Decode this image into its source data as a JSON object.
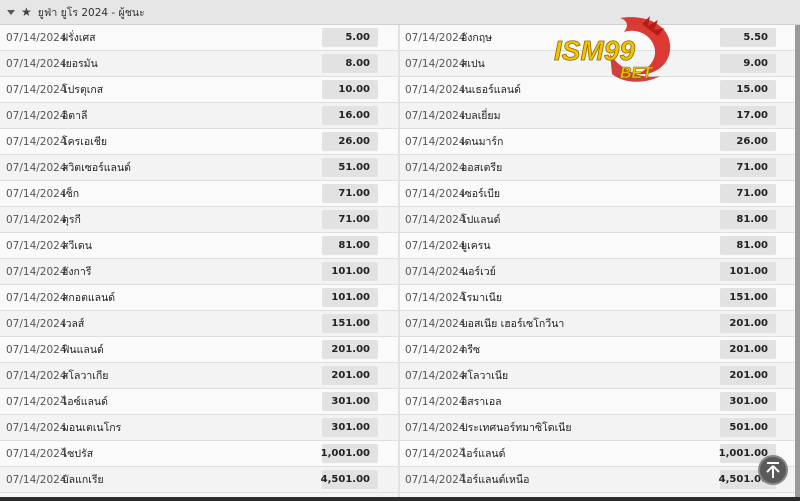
{
  "header": {
    "title": "ยูฟ่า ยูโร 2024 - ผู้ชนะ"
  },
  "logo": {
    "text_main": "ISM99",
    "text_sub": "BET"
  },
  "rows": [
    {
      "l_date": "07/14/2024",
      "l_team": "ฝรั่งเศส",
      "l_odds": "5.00",
      "r_date": "07/14/2024",
      "r_team": "อังกฤษ",
      "r_odds": "5.50"
    },
    {
      "l_date": "07/14/2024",
      "l_team": "เยอรมัน",
      "l_odds": "8.00",
      "r_date": "07/14/2024",
      "r_team": "สเปน",
      "r_odds": "9.00"
    },
    {
      "l_date": "07/14/2024",
      "l_team": "โปรตุเกส",
      "l_odds": "10.00",
      "r_date": "07/14/2024",
      "r_team": "เนเธอร์แลนด์",
      "r_odds": "15.00"
    },
    {
      "l_date": "07/14/2024",
      "l_team": "อิตาลี",
      "l_odds": "16.00",
      "r_date": "07/14/2024",
      "r_team": "เบลเยี่ยม",
      "r_odds": "17.00"
    },
    {
      "l_date": "07/14/2024",
      "l_team": "โครเอเชีย",
      "l_odds": "26.00",
      "r_date": "07/14/2024",
      "r_team": "เดนมาร์ก",
      "r_odds": "26.00"
    },
    {
      "l_date": "07/14/2024",
      "l_team": "สวิตเซอร์แลนด์",
      "l_odds": "51.00",
      "r_date": "07/14/2024",
      "r_team": "ออสเตรีย",
      "r_odds": "71.00"
    },
    {
      "l_date": "07/14/2024",
      "l_team": "เช็ก",
      "l_odds": "71.00",
      "r_date": "07/14/2024",
      "r_team": "เซอร์เบีย",
      "r_odds": "71.00"
    },
    {
      "l_date": "07/14/2024",
      "l_team": "ตุรกี",
      "l_odds": "71.00",
      "r_date": "07/14/2024",
      "r_team": "โปแลนด์",
      "r_odds": "81.00"
    },
    {
      "l_date": "07/14/2024",
      "l_team": "สวีเดน",
      "l_odds": "81.00",
      "r_date": "07/14/2024",
      "r_team": "ยูเครน",
      "r_odds": "81.00"
    },
    {
      "l_date": "07/14/2024",
      "l_team": "ฮังการี",
      "l_odds": "101.00",
      "r_date": "07/14/2024",
      "r_team": "นอร์เวย์",
      "r_odds": "101.00"
    },
    {
      "l_date": "07/14/2024",
      "l_team": "สกอตแลนด์",
      "l_odds": "101.00",
      "r_date": "07/14/2024",
      "r_team": "โรมาเนีย",
      "r_odds": "151.00"
    },
    {
      "l_date": "07/14/2024",
      "l_team": "เวลส์",
      "l_odds": "151.00",
      "r_date": "07/14/2024",
      "r_team": "บอสเนีย เฮอร์เซโกวีนา",
      "r_odds": "201.00"
    },
    {
      "l_date": "07/14/2024",
      "l_team": "ฟินแลนด์",
      "l_odds": "201.00",
      "r_date": "07/14/2024",
      "r_team": "กรีซ",
      "r_odds": "201.00"
    },
    {
      "l_date": "07/14/2024",
      "l_team": "สโลวาเกีย",
      "l_odds": "201.00",
      "r_date": "07/14/2024",
      "r_team": "สโลวาเนีย",
      "r_odds": "201.00"
    },
    {
      "l_date": "07/14/2024",
      "l_team": "ไอซ์แลนด์",
      "l_odds": "301.00",
      "r_date": "07/14/2024",
      "r_team": "อิสราเอล",
      "r_odds": "301.00"
    },
    {
      "l_date": "07/14/2024",
      "l_team": "มอนเตเนโกร",
      "l_odds": "301.00",
      "r_date": "07/14/2024",
      "r_team": "ประเทศนอร์ทมาซิโดเนีย",
      "r_odds": "501.00"
    },
    {
      "l_date": "07/14/2024",
      "l_team": "ไซปรัส",
      "l_odds": "1,001.00",
      "r_date": "07/14/2024",
      "r_team": "ไอร์แลนด์",
      "r_odds": "1,001.00"
    },
    {
      "l_date": "07/14/2024",
      "l_team": "บัลแกเรีย",
      "l_odds": "4,501.00",
      "r_date": "07/14/2024",
      "r_team": "ไอร์แลนด์เหนือ",
      "r_odds": "4,501.00"
    }
  ]
}
